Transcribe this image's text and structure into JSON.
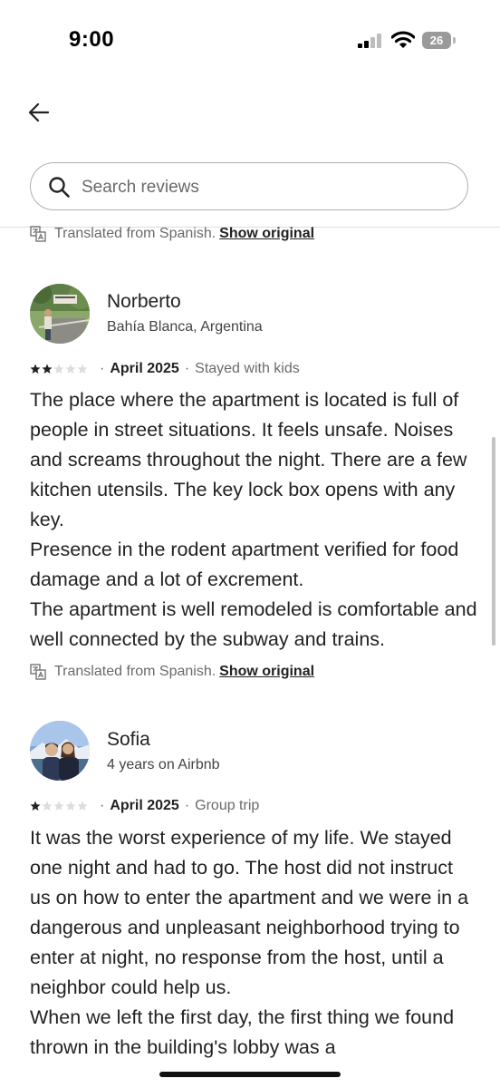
{
  "status_bar": {
    "time": "9:00",
    "battery": "26"
  },
  "search": {
    "placeholder": "Search reviews",
    "value": ""
  },
  "translation_notice": {
    "text": "Translated from Spanish.",
    "link": "Show original"
  },
  "reviews": [
    {
      "name": "Norberto",
      "subtitle": "Bahía Blanca, Argentina",
      "rating": 2,
      "date": "April 2025",
      "trip": "Stayed with kids",
      "paragraphs": [
        "The place where the apartment is located is full of people in street situations. It feels unsafe. Noises and screams throughout the night. There are a few kitchen utensils. The key lock box opens with any key.",
        "Presence in the rodent apartment verified for food damage and a lot of excrement.",
        "The apartment is well remodeled is comfortable and well connected by the subway and trains."
      ],
      "translated": {
        "text": "Translated from Spanish.",
        "link": "Show original"
      }
    },
    {
      "name": "Sofia",
      "subtitle": "4 years on Airbnb",
      "rating": 1,
      "date": "April 2025",
      "trip": "Group trip",
      "paragraphs": [
        "It was the worst experience of my life. We stayed one night and had to go. The host did not instruct us on how to enter the apartment and we were in a dangerous and unpleasant neighborhood trying to enter at night, no response from the host, until a neighbor could help us.",
        "When we left the first day, the first thing we found thrown in the building's lobby was a"
      ]
    }
  ],
  "colors": {
    "text": "#222222",
    "muted": "#6a6a6a",
    "star": "#222222",
    "star_empty": "#dddddd",
    "border": "#b0b0b0"
  }
}
